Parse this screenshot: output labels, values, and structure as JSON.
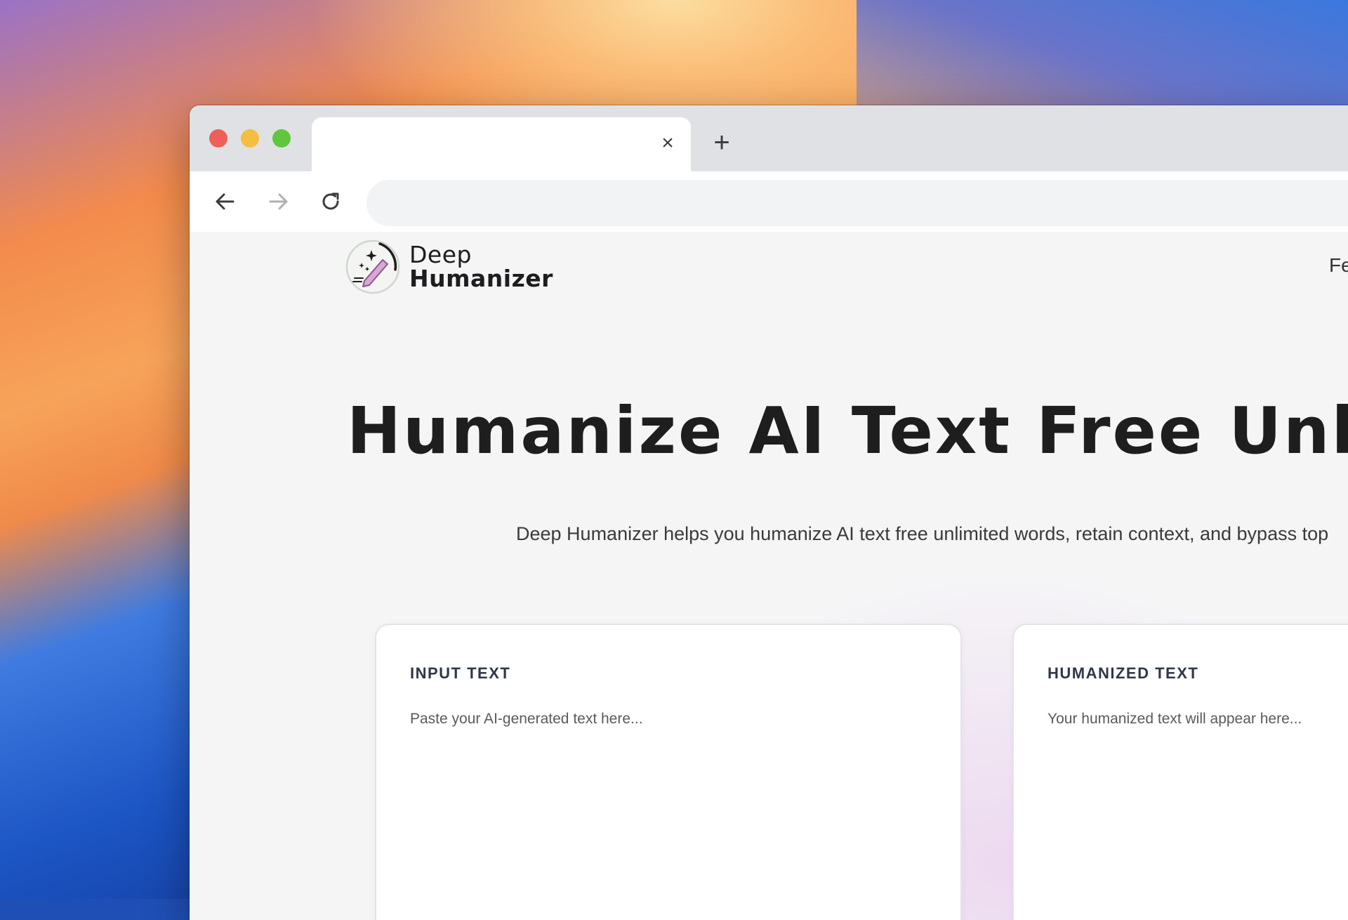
{
  "browser": {
    "new_tab_symbol": "+",
    "close_tab_symbol": "×"
  },
  "site": {
    "logo_line1": "Deep",
    "logo_line2": "Humanizer",
    "nav_partial": "Fe"
  },
  "hero": {
    "title": "Humanize AI Text Free Unlimite",
    "subtitle": "Deep Humanizer helps you humanize AI text free unlimited words, retain context, and bypass top"
  },
  "input_card": {
    "title": "INPUT TEXT",
    "placeholder": "Paste your AI-generated text here..."
  },
  "output_card": {
    "title": "HUMANIZED TEXT",
    "placeholder": "Your humanized text will appear here..."
  },
  "colors": {
    "accent_pen": "#d9a6d6",
    "traffic_red": "#ee5f57",
    "traffic_yellow": "#f4be3f",
    "traffic_green": "#5fc63e"
  },
  "icons": [
    "back-arrow-icon",
    "forward-arrow-icon",
    "reload-icon",
    "close-icon",
    "plus-icon",
    "logo-icon"
  ]
}
